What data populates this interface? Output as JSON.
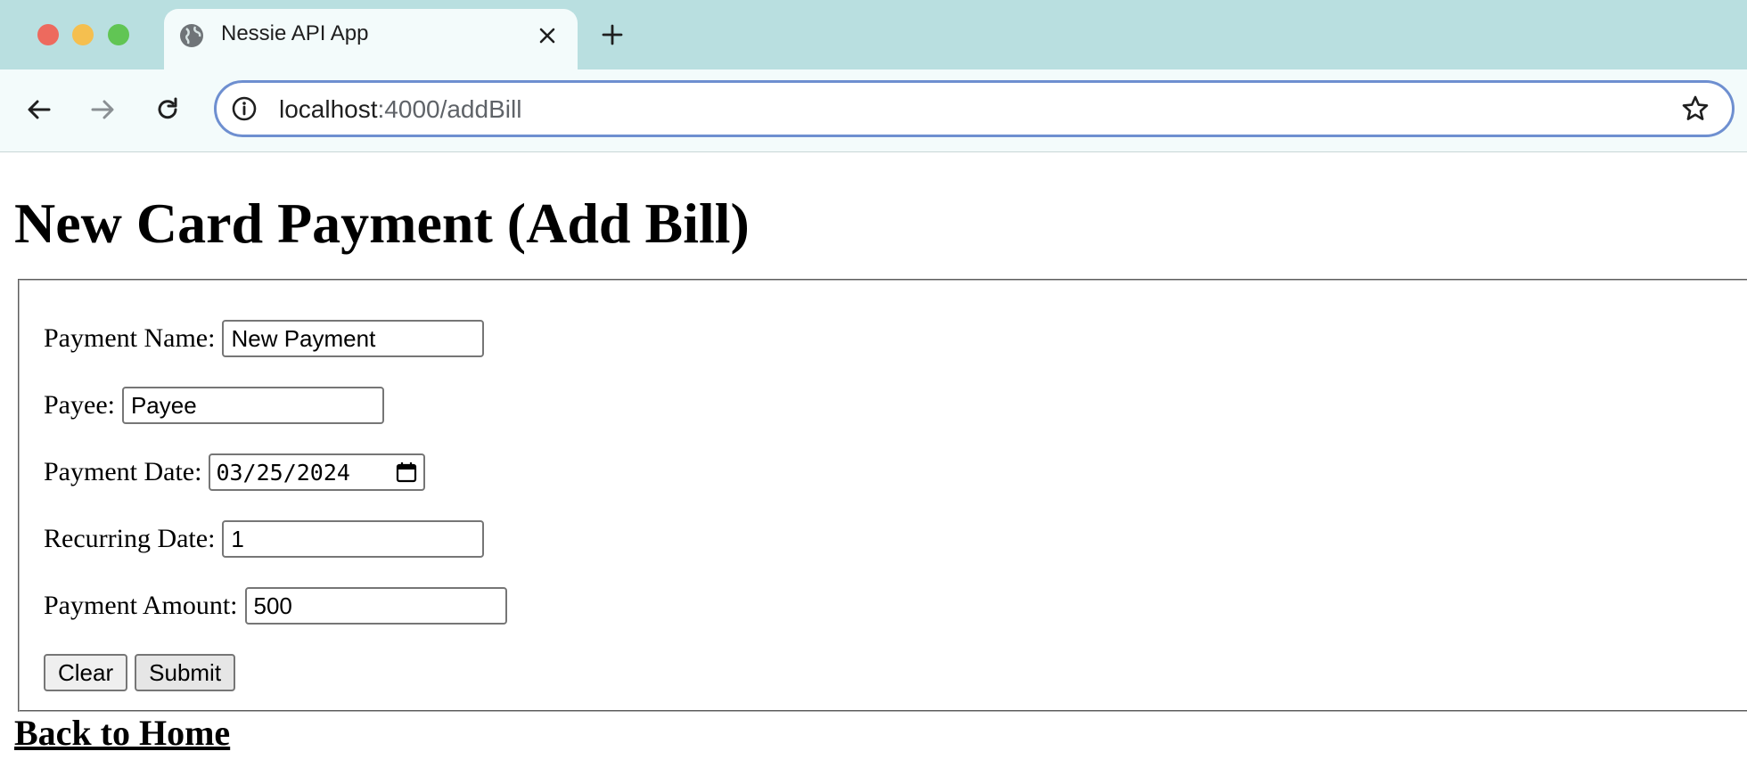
{
  "browser": {
    "tab_title": "Nessie API App",
    "url_host": "localhost",
    "url_path": ":4000/addBill"
  },
  "page": {
    "heading": "New Card Payment (Add Bill)",
    "form": {
      "payment_name": {
        "label": "Payment Name:",
        "value": "New Payment"
      },
      "payee": {
        "label": "Payee:",
        "value": "Payee"
      },
      "payment_date": {
        "label": "Payment Date:",
        "value": "03/25/2024"
      },
      "recurring_date": {
        "label": "Recurring Date:",
        "value": "1"
      },
      "payment_amount": {
        "label": "Payment Amount:",
        "value": "500"
      },
      "clear_label": "Clear",
      "submit_label": "Submit"
    },
    "back_link": "Back to Home"
  }
}
